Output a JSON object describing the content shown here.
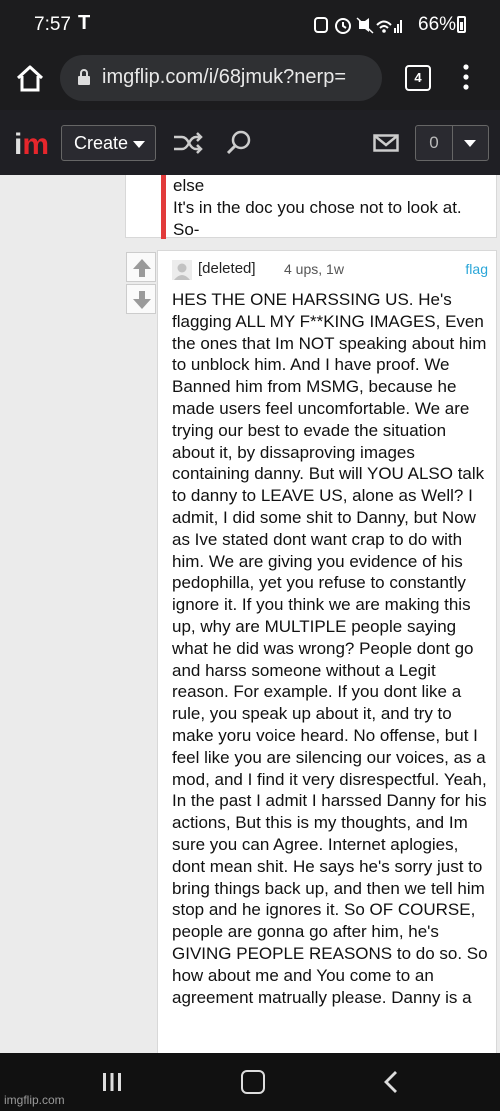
{
  "status": {
    "time": "7:57",
    "carrier_icon": "T",
    "icons": [
      "app-icon",
      "alarm-icon",
      "mute-icon",
      "wifi-icon",
      "signal-icon"
    ],
    "battery_text": "66%"
  },
  "browser": {
    "url": "imgflip.com/i/68jmuk?nerp=",
    "tab_count": "4"
  },
  "header": {
    "logo_i": "i",
    "logo_m": "m",
    "create_label": "Create",
    "notif_count": "0"
  },
  "prev_comment": {
    "lines": [
      "else",
      "It's in the doc you chose not to look at.",
      "So-"
    ]
  },
  "comment": {
    "author": "[deleted]",
    "meta": "4 ups, 1w",
    "flag": "flag",
    "body": "HES THE ONE HARSSING US. He's flagging ALL MY F**KING IMAGES, Even the ones that Im NOT speaking about him to unblock him. And I have proof. We Banned him from MSMG, because he made users feel uncomfortable. We are trying our best to evade the situation about it, by dissaproving images containing danny. But will YOU ALSO talk to danny to LEAVE US, alone as Well? I admit, I did some shit to Danny, but Now as Ive stated dont want crap to do with him. We are giving you evidence of his pedophilla, yet you refuse to constantly ignore it. If you think we are making this up, why are MULTIPLE people saying what he did was wrong? People dont go and harss someone without a Legit reason. For example. If you dont like a rule, you speak up about it, and try to make yoru voice heard. No offense, but I feel like you are silencing our voices, as a mod, and I find it very disrespectful. Yeah, In the past I admit I harssed Danny for his actions, But this is my thoughts, and Im sure you can Agree. Internet aplogies, dont mean shit. He says he's sorry just to bring things back up, and then we tell him stop and he ignores it. So OF COURSE, people are gonna go after him, he's GIVING PEOPLE REASONS to do so. So how about me and You come to an agreement matrually please. Danny is a"
  },
  "watermark": "imgflip.com",
  "colors": {
    "accent_red": "#e23b3b",
    "flag_blue": "#2aa6d8",
    "header_bg": "#1f1f24"
  }
}
